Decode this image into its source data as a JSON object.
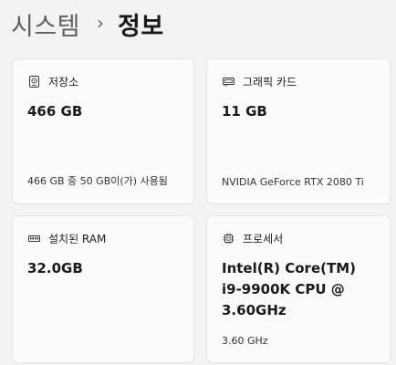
{
  "breadcrumb": {
    "parent": "시스템",
    "separator": "›",
    "current": "정보"
  },
  "cards": [
    {
      "icon": "hard-drive-icon",
      "title": "저장소",
      "value": "466 GB",
      "subtitle": "466 GB 중 50 GB이(가) 사용됨"
    },
    {
      "icon": "graphics-card-icon",
      "title": "그래픽 카드",
      "value": "11 GB",
      "subtitle": "NVIDIA GeForce RTX 2080 Ti"
    },
    {
      "icon": "memory-icon",
      "title": "설치된 RAM",
      "value": "32.0GB",
      "subtitle": ""
    },
    {
      "icon": "processor-icon",
      "title": "프로세서",
      "value": "Intel(R) Core(TM) i9-9900K CPU @ 3.60GHz",
      "subtitle": "3.60 GHz"
    }
  ],
  "colors": {
    "background": "#f3f3f3",
    "card": "#fbfbfb",
    "card_border": "#e3e3e3",
    "text_primary": "#1a1a1a",
    "text_secondary": "#5f5f5f"
  }
}
